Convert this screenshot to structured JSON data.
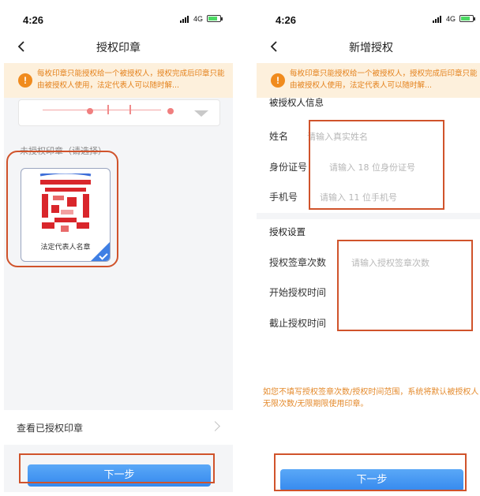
{
  "status_bar": {
    "time": "4:26",
    "network": "4G"
  },
  "notice": {
    "text": "每枚印章只能授权给一个被授权人，授权完成后印章只能由被授权人使用，法定代表人可以随时解..."
  },
  "left_screen": {
    "title": "授权印章",
    "unauthorized_label": "未授权印章（请选择）",
    "seal_caption": "法定代表人名章",
    "view_authorized": "查看已授权印章",
    "next_button": "下一步"
  },
  "right_screen": {
    "title": "新增授权",
    "grantee_section": "被授权人信息",
    "name_label": "姓名",
    "name_placeholder": "请输入真实姓名",
    "id_label": "身份证号",
    "id_placeholder": "请输入 18 位身份证号",
    "phone_label": "手机号",
    "phone_placeholder": "请输入 11 位手机号",
    "settings_section": "授权设置",
    "count_label": "授权签章次数",
    "count_placeholder": "请输入授权签章次数",
    "start_label": "开始授权时间",
    "end_label": "截止授权时间",
    "footnote": "如您不填写授权签章次数/授权时间范围，系统将默认被授权人无限次数/无限期限使用印章。",
    "next_button": "下一步"
  },
  "colors": {
    "primary_blue": "#3589ee",
    "notice_orange": "#e4811b",
    "annotation_red": "#d0532b"
  },
  "icons": [
    "back-arrow-icon",
    "info-icon",
    "dropdown-caret-icon",
    "check-icon",
    "chevron-right-icon",
    "signal-icon",
    "battery-icon"
  ]
}
